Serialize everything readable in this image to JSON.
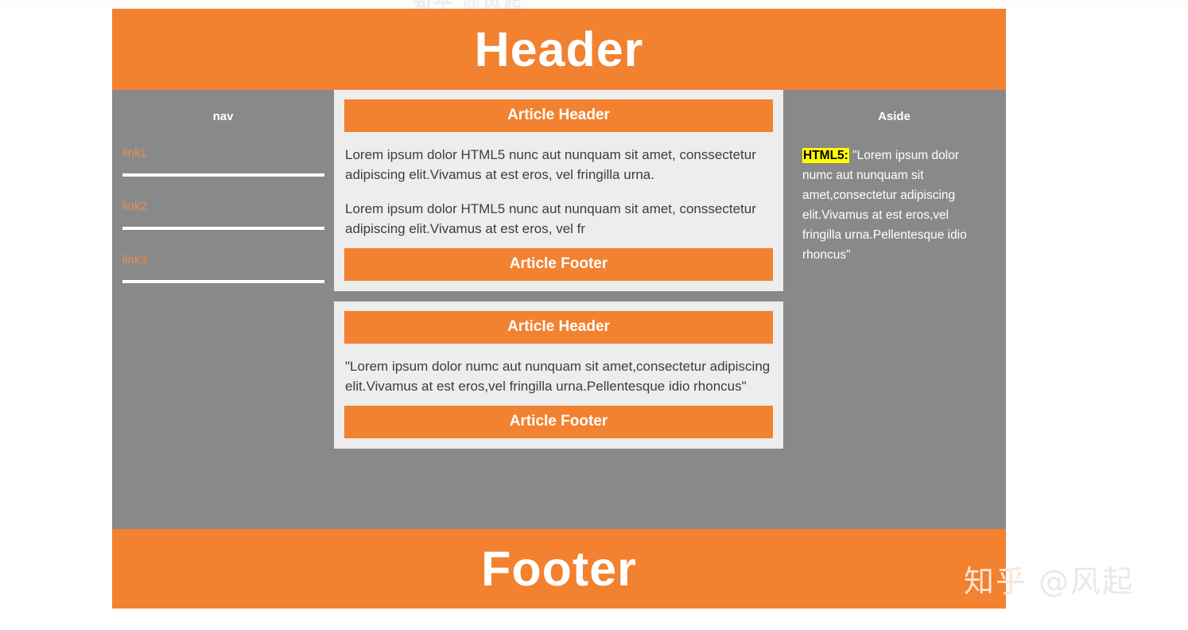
{
  "watermark": {
    "logo": "知乎",
    "handle": "@风起",
    "ghost_top": "知乎 @风起"
  },
  "colors": {
    "accent_orange": "#F28130",
    "body_gray": "#898989",
    "panel_gray": "#EDEDED",
    "link_orange": "#F08A4B",
    "highlight_yellow": "#FFFF00"
  },
  "header": {
    "title": "Header"
  },
  "footer": {
    "title": "Footer"
  },
  "nav": {
    "title": "nav",
    "links": [
      {
        "label": "link1"
      },
      {
        "label": "link2"
      },
      {
        "label": "link3"
      }
    ]
  },
  "section": {
    "articles": [
      {
        "header": "Article Header",
        "paragraphs": [
          "Lorem ipsum dolor HTML5 nunc aut nunquam sit amet, conssectetur adipiscing elit.Vivamus at est eros, vel fringilla urna.",
          "Lorem ipsum dolor HTML5 nunc aut nunquam sit amet, conssectetur adipiscing elit.Vivamus at est eros, vel fr"
        ],
        "footer": "Article Footer"
      },
      {
        "header": "Article Header",
        "paragraphs": [
          "\"Lorem ipsum dolor numc aut nunquam sit amet,consectetur adipiscing elit.Vivamus at est eros,vel fringilla urna.Pellentesque idio rhoncus\""
        ],
        "footer": "Article Footer"
      }
    ]
  },
  "aside": {
    "title": "Aside",
    "mark_label": "HTML5:",
    "body": " \"Lorem ipsum dolor numc aut nunquam sit amet,consectetur adipiscing elit.Vivamus at est eros,vel fringilla urna.Pellentesque idio rhoncus\""
  }
}
